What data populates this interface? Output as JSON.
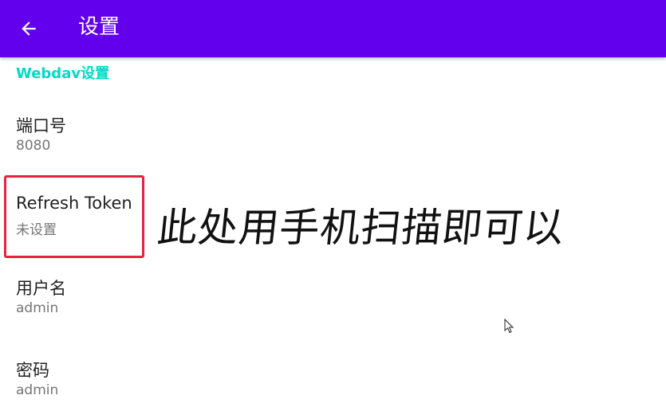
{
  "appbar": {
    "title": "设置",
    "color": "#6200ee"
  },
  "section": {
    "header": "Webdav设置",
    "color": "#03dac5"
  },
  "preferences": [
    {
      "title": "端口号",
      "summary": "8080"
    },
    {
      "title": "Refresh Token",
      "summary": "未设置"
    },
    {
      "title": "用户名",
      "summary": "admin"
    },
    {
      "title": "密码",
      "summary": "admin"
    }
  ],
  "annotation": {
    "text": "此处用手机扫描即可以",
    "box_color": "#e8213f"
  },
  "icons": {
    "back": "arrow-back-icon",
    "cursor": "mouse-pointer-icon"
  }
}
